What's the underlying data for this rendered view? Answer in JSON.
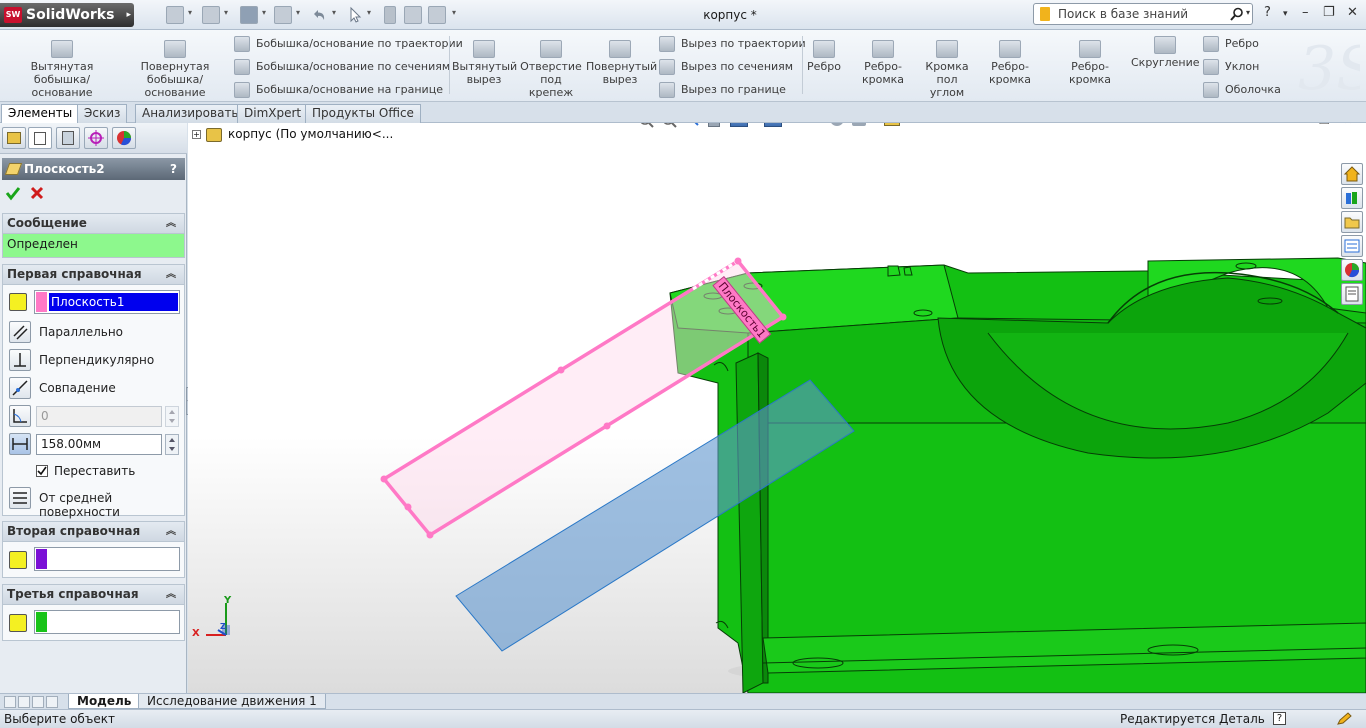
{
  "app": {
    "name": "SolidWorks",
    "logo_abbr": "SW",
    "document_title": "корпус *"
  },
  "search": {
    "placeholder": "Поиск в базе знаний"
  },
  "title_buttons": {
    "help": "?",
    "help_arrow": "▾",
    "minimize": "–",
    "restore": "❐",
    "close": "✕"
  },
  "ribbon": {
    "group1": [
      {
        "label": "Вытянутая бобышка/основание"
      },
      {
        "label": "Повернутая бобышка/основание"
      }
    ],
    "group1_small": [
      {
        "label": "Бобышка/основание по траектории"
      },
      {
        "label": "Бобышка/основание по сечениям"
      },
      {
        "label": "Бобышка/основание на границе"
      }
    ],
    "group2": [
      {
        "label": "Вытянутый вырез"
      },
      {
        "label": "Отверстие под крепеж"
      },
      {
        "label": "Повернутый вырез"
      }
    ],
    "group2_small": [
      {
        "label": "Вырез по траектории"
      },
      {
        "label": "Вырез по сечениям"
      },
      {
        "label": "Вырез по границе"
      }
    ],
    "group3": [
      {
        "label": "Ребро"
      },
      {
        "label": "Ребро-кромка"
      },
      {
        "label": "Кромка пол углом"
      },
      {
        "label": "Ребро-кромка"
      },
      {
        "label": "Ребро-кромка"
      },
      {
        "label": "Скругление"
      }
    ],
    "group3_small": [
      {
        "label": "Ребро"
      },
      {
        "label": "Уклон"
      },
      {
        "label": "Оболочка"
      }
    ]
  },
  "tabs": [
    {
      "label": "Элементы",
      "active": true
    },
    {
      "label": "Эскиз"
    },
    {
      "label": "Анализировать"
    },
    {
      "label": "DimXpert"
    },
    {
      "label": "Продукты Office"
    }
  ],
  "property_manager": {
    "title": "Плоскость2",
    "help": "?",
    "message": {
      "header": "Сообщение",
      "text": "Определен"
    },
    "first_ref": {
      "header": "Первая справочная",
      "selection": "Плоскость1",
      "options": [
        "Параллельно",
        "Перпендикулярно",
        "Совпадение"
      ],
      "angle_value": "0",
      "distance_value": "158.00мм",
      "flip_label": "Переставить",
      "flip_checked": true,
      "mid_label": "От средней поверхности"
    },
    "second_ref": {
      "header": "Вторая справочная"
    },
    "third_ref": {
      "header": "Третья справочная"
    },
    "colors": {
      "first": "#ff79c6",
      "second": "#7a10d6",
      "third": "#18c318",
      "selection_bg": "#0000ee",
      "message_bg": "#8df88d"
    }
  },
  "tree": {
    "root": "корпус  (По умолчанию<..."
  },
  "viewport": {
    "plane_label": "Плоскость1",
    "model_color": "#15c215",
    "triad": {
      "x": "X",
      "y": "Y",
      "z": "Z"
    }
  },
  "bottom_tabs": [
    {
      "label": "Модель",
      "active": true
    },
    {
      "label": "Исследование движения 1"
    }
  ],
  "status": {
    "left": "Выберите объект",
    "right": "Редактируется Деталь",
    "help": "?"
  }
}
